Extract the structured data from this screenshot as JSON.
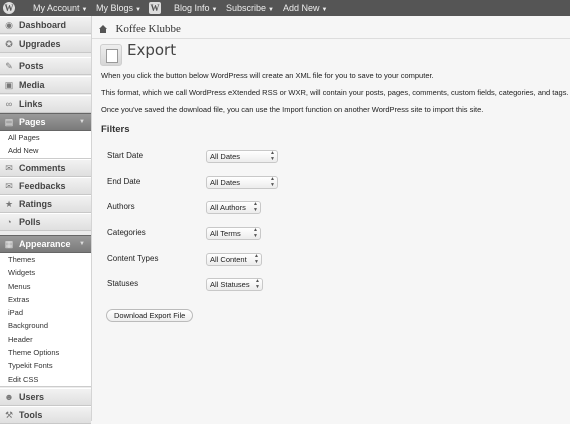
{
  "admin_bar": {
    "items": [
      {
        "label": "My Account",
        "has_menu": true
      },
      {
        "label": "My Blogs",
        "has_menu": true
      },
      {
        "label": "Blog Info",
        "has_menu": true
      },
      {
        "label": "Subscribe",
        "has_menu": true
      },
      {
        "label": "Add New",
        "has_menu": true
      }
    ]
  },
  "sidebar": {
    "top": [
      {
        "label": "Dashboard",
        "icon": "dashboard-icon"
      },
      {
        "label": "Upgrades",
        "icon": "upgrades-icon"
      },
      {
        "label": "Posts",
        "icon": "pin-icon"
      },
      {
        "label": "Media",
        "icon": "media-icon"
      },
      {
        "label": "Links",
        "icon": "links-icon"
      },
      {
        "label": "Pages",
        "icon": "pages-icon",
        "current": true
      }
    ],
    "pages_sub": [
      "All Pages",
      "Add New"
    ],
    "middle": [
      {
        "label": "Comments",
        "icon": "comments-icon"
      },
      {
        "label": "Feedbacks",
        "icon": "feedbacks-icon"
      },
      {
        "label": "Ratings",
        "icon": "ratings-icon"
      },
      {
        "label": "Polls",
        "icon": "polls-icon"
      },
      {
        "label": "Appearance",
        "icon": "appearance-icon",
        "current": true
      }
    ],
    "appearance_sub": [
      "Themes",
      "Widgets",
      "Menus",
      "Extras",
      "iPad",
      "Background",
      "Header",
      "Theme Options",
      "Typekit Fonts",
      "Edit CSS"
    ],
    "bottom": [
      {
        "label": "Users",
        "icon": "users-icon"
      },
      {
        "label": "Tools",
        "icon": "tools-icon"
      }
    ]
  },
  "site": {
    "title": "Koffee Klubbe"
  },
  "page": {
    "title": "Export",
    "paragraphs": [
      "When you click the button below WordPress will create an XML file for you to save to your computer.",
      "This format, which we call WordPress eXtended RSS or WXR, will contain your posts, pages, comments, custom fields, categories, and tags.",
      "Once you've saved the download file, you can use the Import function on another WordPress site to import this site."
    ],
    "filters_heading": "Filters",
    "filters": [
      {
        "label": "Start Date",
        "value": "All Dates"
      },
      {
        "label": "End Date",
        "value": "All Dates"
      },
      {
        "label": "Authors",
        "value": "All Authors"
      },
      {
        "label": "Categories",
        "value": "All Terms"
      },
      {
        "label": "Content Types",
        "value": "All Content"
      },
      {
        "label": "Statuses",
        "value": "All Statuses"
      }
    ],
    "download_button": "Download Export File"
  }
}
